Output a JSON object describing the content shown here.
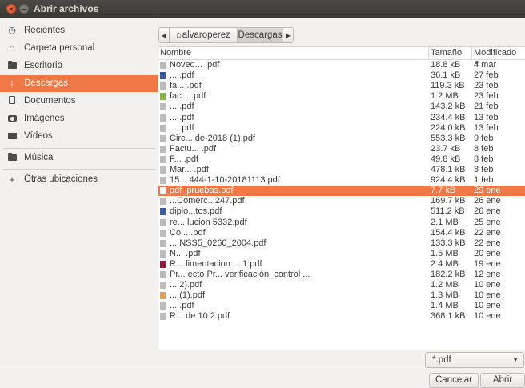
{
  "window": {
    "title": "Abrir archivos"
  },
  "sidebar": {
    "items": [
      {
        "label": "Recientes",
        "icon": "clock-icon"
      },
      {
        "label": "Carpeta personal",
        "icon": "home-icon"
      },
      {
        "label": "Escritorio",
        "icon": "folder-icon"
      },
      {
        "label": "Descargas",
        "icon": "download-icon",
        "active": true
      },
      {
        "label": "Documentos",
        "icon": "document-icon"
      },
      {
        "label": "Imágenes",
        "icon": "camera-icon"
      },
      {
        "label": "Vídeos",
        "icon": "video-icon"
      },
      {
        "label": "Música",
        "icon": "folder-icon"
      },
      {
        "label": "Otras ubicaciones",
        "icon": "plus-icon"
      }
    ]
  },
  "pathbar": {
    "home": "alvaroperez",
    "current": "Descargas"
  },
  "columns": {
    "name": "Nombre",
    "size": "Tamaño",
    "modified": "Modificado"
  },
  "files": [
    {
      "name": "Noved... .pdf",
      "size": "18.8 kB",
      "date": "4 mar",
      "color": "#bbbbbb"
    },
    {
      "name": "... .pdf",
      "size": "36.1 kB",
      "date": "27 feb",
      "color": "#3b5aa0"
    },
    {
      "name": "fa... .pdf",
      "size": "119.3 kB",
      "date": "23 feb",
      "color": "#bbbbbb"
    },
    {
      "name": "fac... .pdf",
      "size": "1.2 MB",
      "date": "23 feb",
      "color": "#88b04b"
    },
    {
      "name": "... .pdf",
      "size": "143.2 kB",
      "date": "21 feb",
      "color": "#bbbbbb"
    },
    {
      "name": "... .pdf",
      "size": "234.4 kB",
      "date": "13 feb",
      "color": "#bbbbbb"
    },
    {
      "name": "... .pdf",
      "size": "224.0 kB",
      "date": "13 feb",
      "color": "#bbbbbb"
    },
    {
      "name": "Circ... de-2018 (1).pdf",
      "size": "553.3 kB",
      "date": "9 feb",
      "color": "#bbbbbb"
    },
    {
      "name": "Factu... .pdf",
      "size": "23.7 kB",
      "date": "8 feb",
      "color": "#bbbbbb"
    },
    {
      "name": "F... .pdf",
      "size": "49.8 kB",
      "date": "8 feb",
      "color": "#bbbbbb"
    },
    {
      "name": "Mar... .pdf",
      "size": "478.1 kB",
      "date": "8 feb",
      "color": "#bbbbbb"
    },
    {
      "name": "15... 444-1-10-20181113.pdf",
      "size": "924.4 kB",
      "date": "1 feb",
      "color": "#bbbbbb"
    },
    {
      "name": "pdf_pruebas.pdf",
      "size": "7.7 kB",
      "date": "29 ene",
      "color": "#ffffff",
      "selected": true
    },
    {
      "name": "...Comerc...247.pdf",
      "size": "169.7 kB",
      "date": "26 ene",
      "color": "#bbbbbb"
    },
    {
      "name": "diplo...tos.pdf",
      "size": "511.2 kB",
      "date": "26 ene",
      "color": "#3b5aa0"
    },
    {
      "name": "re... lucion 5332.pdf",
      "size": "2.1 MB",
      "date": "25 ene",
      "color": "#bbbbbb"
    },
    {
      "name": "Co... .pdf",
      "size": "154.4 kB",
      "date": "22 ene",
      "color": "#bbbbbb"
    },
    {
      "name": "... NSS5_0260_2004.pdf",
      "size": "133.3 kB",
      "date": "22 ene",
      "color": "#bbbbbb"
    },
    {
      "name": "N... .pdf",
      "size": "1.5 MB",
      "date": "20 ene",
      "color": "#bbbbbb"
    },
    {
      "name": "R... limentacion ... 1.pdf",
      "size": "2.4 MB",
      "date": "19 ene",
      "color": "#8a1f3b"
    },
    {
      "name": "Pr... ecto Pr... verificación_control ...",
      "size": "182.2 kB",
      "date": "12 ene",
      "color": "#bbbbbb"
    },
    {
      "name": "... 2).pdf",
      "size": "1.2 MB",
      "date": "10 ene",
      "color": "#bbbbbb"
    },
    {
      "name": "... (1).pdf",
      "size": "1.3 MB",
      "date": "10 ene",
      "color": "#e0a060"
    },
    {
      "name": "... .pdf",
      "size": "1.4 MB",
      "date": "10 ene",
      "color": "#bbbbbb"
    },
    {
      "name": "R... de 10 2.pdf",
      "size": "368.1 kB",
      "date": "10 ene",
      "color": "#bbbbbb"
    }
  ],
  "filter": {
    "label": "*.pdf"
  },
  "buttons": {
    "cancel": "Cancelar",
    "open": "Abrir"
  },
  "colors": {
    "accent": "#f07746",
    "titlebar": "#3c3b37"
  }
}
